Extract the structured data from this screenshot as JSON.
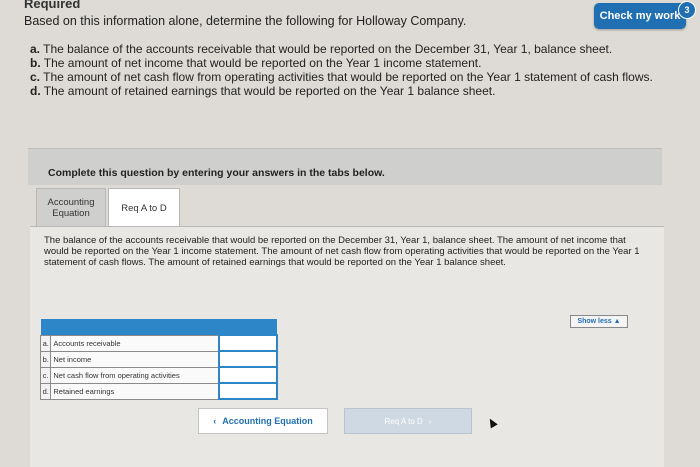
{
  "header": {
    "title": "Required",
    "check_label": "Check my work",
    "badge_count": "3"
  },
  "question": {
    "intro": "Based on this information alone, determine the following for Holloway Company.",
    "items": [
      {
        "letter": "a.",
        "text": "The balance of the accounts receivable that would be reported on the December 31, Year 1, balance sheet."
      },
      {
        "letter": "b.",
        "text": "The amount of net income that would be reported on the Year 1 income statement."
      },
      {
        "letter": "c.",
        "text": "The amount of net cash flow from operating activities that would be reported on the Year 1 statement of cash flows."
      },
      {
        "letter": "d.",
        "text": "The amount of retained earnings that would be reported on the Year 1 balance sheet."
      }
    ]
  },
  "instructions": "Complete this question by entering your answers in the tabs below.",
  "tabs": [
    {
      "label_line1": "Accounting",
      "label_line2": "Equation"
    },
    {
      "label": "Req A to D"
    }
  ],
  "panel": {
    "text": "The balance of the accounts receivable that would be reported on the December 31, Year 1, balance sheet. The amount of net income that would be reported on the Year 1 income statement. The amount of net cash flow from operating activities that would be reported on the Year 1 statement of cash flows. The amount of retained earnings that would be reported on the Year 1 balance sheet.",
    "show_less": "Show less ▲"
  },
  "answers": [
    {
      "letter": "a.",
      "label": "Accounts receivable",
      "value": ""
    },
    {
      "letter": "b.",
      "label": "Net income",
      "value": ""
    },
    {
      "letter": "c.",
      "label": "Net cash flow from operating activities",
      "value": ""
    },
    {
      "letter": "d.",
      "label": "Retained earnings",
      "value": ""
    }
  ],
  "nav": {
    "prev_label": "Accounting Equation",
    "next_label": "Req A to D"
  },
  "colors": {
    "accent": "#1f6fb2",
    "table_header": "#2d86c8"
  }
}
